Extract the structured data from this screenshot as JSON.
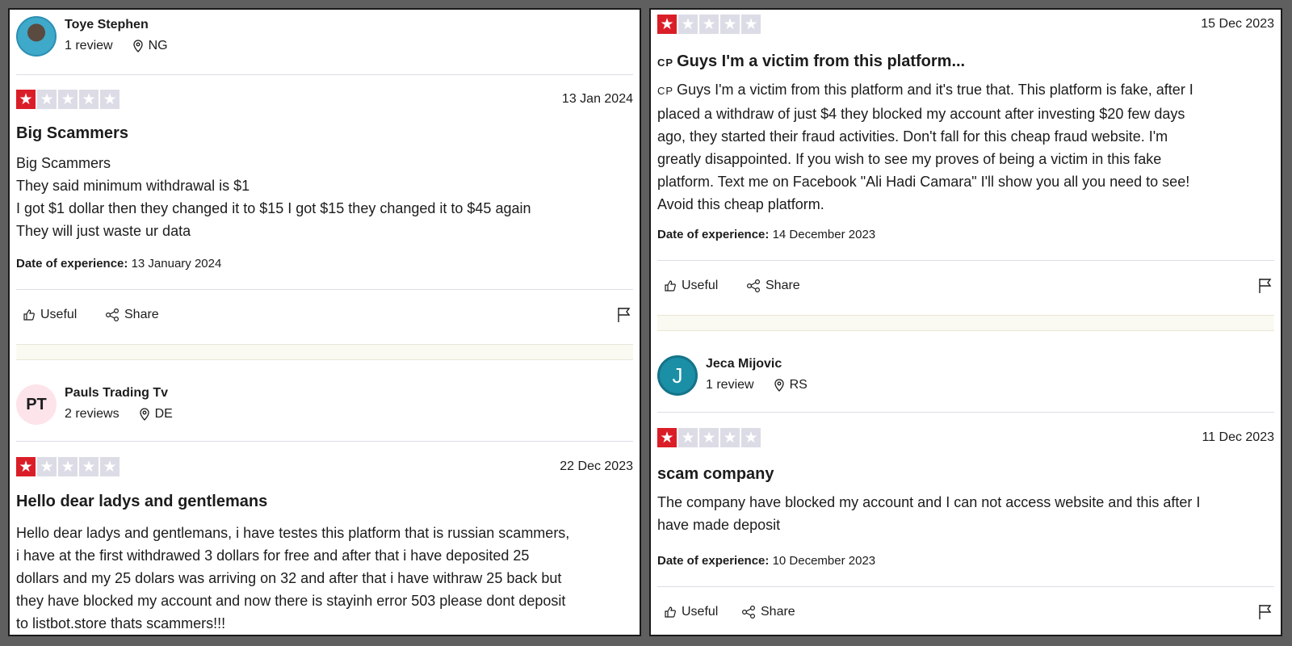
{
  "left": {
    "review1": {
      "author": "Toye Stephen",
      "reviews": "1 review",
      "country": "NG",
      "rating": 1,
      "date": "13 Jan 2024",
      "title": "Big Scammers",
      "body_lines": [
        "Big Scammers",
        "They said minimum withdrawal is $1",
        "I got $1 dollar then they changed it to $15 I got $15 they changed it to $45 again",
        "They will just waste ur data"
      ],
      "exp_label": "Date of experience:",
      "exp_date": "13 January 2024",
      "useful": "Useful",
      "share": "Share"
    },
    "review2": {
      "avatar": "PT",
      "author": "Pauls Trading Tv",
      "reviews": "2 reviews",
      "country": "DE",
      "rating": 1,
      "date": "22 Dec 2023",
      "title": "Hello dear ladys and gentlemans",
      "body_lines": [
        "Hello dear ladys and gentlemans, i have testes this platform that is russian scammers,",
        "i have at the first withdrawed 3 dollars for free and after that i have deposited 25",
        "dollars and my 25 dolars was arriving on 32 and after that i have withraw 25 back but",
        "they have blocked my account and now there is stayinh error 503 please dont deposit",
        "to listbot.store thats scammers!!!"
      ]
    }
  },
  "right": {
    "review1": {
      "rating": 1,
      "date": "15 Dec 2023",
      "title_prefix": "CP",
      "title": "Guys I'm a victim from this platform...",
      "body_prefix": "CP",
      "body_lines": [
        "Guys I'm a victim from this platform and it's true that. This platform is fake, after I",
        "placed a withdraw of just $4 they blocked my account after investing $20 few days",
        "ago, they started their fraud activities. Don't fall for this cheap fraud website. I'm",
        "greatly disappointed. If you wish to see my proves of being a victim in this fake",
        "platform. Text me on Facebook \"Ali Hadi Camara\" I'll show you all you need to see!",
        "Avoid this cheap platform."
      ],
      "exp_label": "Date of experience:",
      "exp_date": "14 December 2023",
      "useful": "Useful",
      "share": "Share"
    },
    "review2": {
      "avatar": "J",
      "author": "Jeca Mijovic",
      "reviews": "1 review",
      "country": "RS",
      "rating": 1,
      "date": "11 Dec 2023",
      "title": "scam company",
      "body_lines": [
        "The company have blocked my account and I can not access website and this after I",
        "have made deposit"
      ],
      "exp_label": "Date of experience:",
      "exp_date": "10 December 2023",
      "useful": "Useful",
      "share": "Share"
    }
  },
  "colors": {
    "star_on": "#da1e28",
    "star_off": "#dcdce6",
    "pt_avatar_bg": "#fde3ea",
    "j_avatar_bg": "#1b8fa6"
  },
  "icons": [
    "location-pin-icon",
    "thumbs-up-icon",
    "share-icon",
    "flag-icon",
    "star-icon"
  ]
}
